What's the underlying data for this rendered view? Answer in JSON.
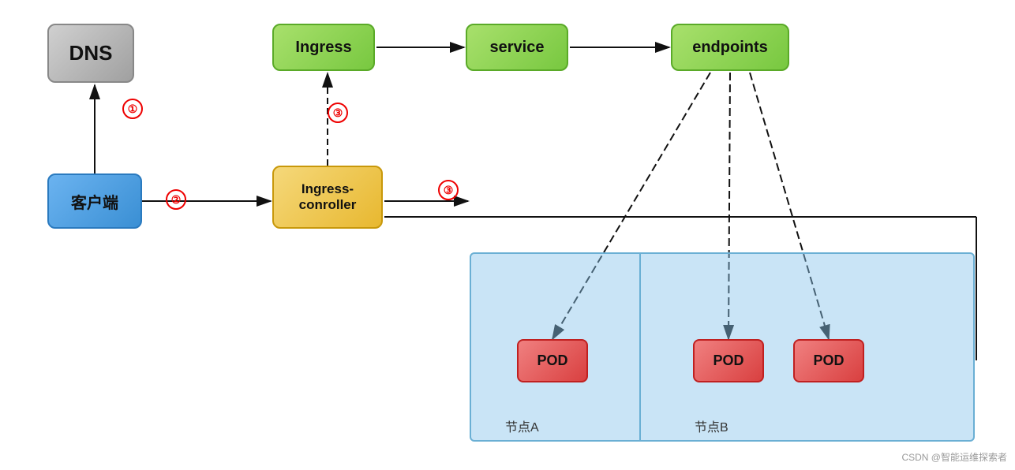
{
  "nodes": {
    "dns": {
      "label": "DNS"
    },
    "client": {
      "label": "客户端"
    },
    "ingress": {
      "label": "Ingress"
    },
    "service": {
      "label": "service"
    },
    "endpoints": {
      "label": "endpoints"
    },
    "ingress_controller": {
      "label": "Ingress-\nconroller"
    },
    "pod1": {
      "label": "POD"
    },
    "pod2": {
      "label": "POD"
    },
    "pod3": {
      "label": "POD"
    }
  },
  "labels": {
    "nodeA": "节点A",
    "nodeB": "节点B",
    "watermark": "CSDN @智能运维探索者",
    "step1": "①",
    "step2": "②",
    "step3a": "③",
    "step3b": "③"
  }
}
